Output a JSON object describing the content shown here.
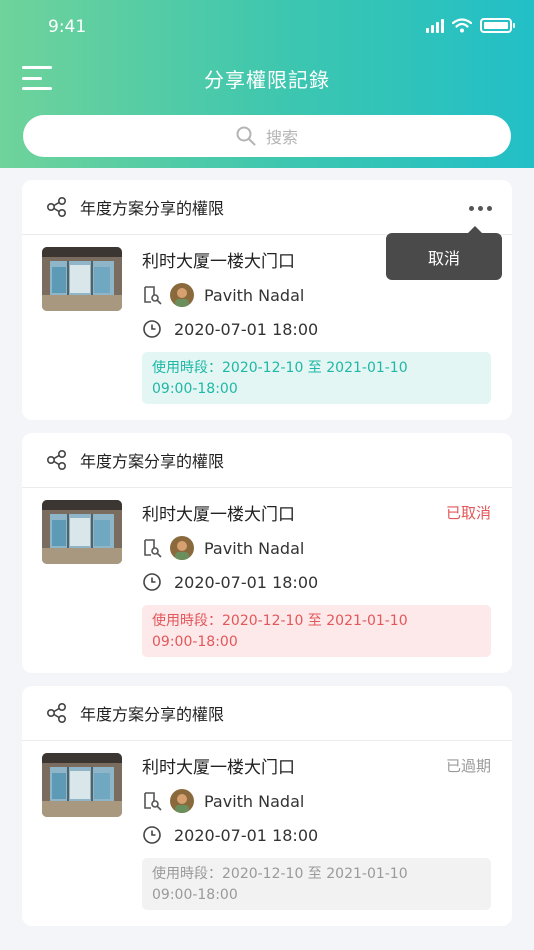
{
  "status_bar": {
    "time": "9:41"
  },
  "header": {
    "title": "分享權限記錄"
  },
  "search": {
    "placeholder": "搜索"
  },
  "cards": [
    {
      "title": "年度方案分享的權限",
      "place": "利时大厦一楼大门口",
      "status": "",
      "user": "Pavith Nadal",
      "datetime": "2020-07-01 18:00",
      "period_line1": "使用時段：2020-12-10 至 2021-01-10",
      "period_line2": "09:00-18:00",
      "state": "active"
    },
    {
      "title": "年度方案分享的權限",
      "place": "利时大厦一楼大门口",
      "status": "已取消",
      "user": "Pavith Nadal",
      "datetime": "2020-07-01 18:00",
      "period_line1": "使用時段：2020-12-10 至 2021-01-10",
      "period_line2": "09:00-18:00",
      "state": "cancelled"
    },
    {
      "title": "年度方案分享的權限",
      "place": "利时大厦一楼大门口",
      "status": "已過期",
      "user": "Pavith Nadal",
      "datetime": "2020-07-01 18:00",
      "period_line1": "使用時段：2020-12-10 至 2021-01-10",
      "period_line2": "09:00-18:00",
      "state": "expired"
    }
  ],
  "popup": {
    "cancel_label": "取消"
  },
  "icons": {
    "menu": "menu-icon",
    "search": "search-icon",
    "share": "share-icon",
    "more": "more-icon",
    "key": "key-icon",
    "clock": "clock-icon"
  },
  "colors": {
    "header_start": "#6fd39a",
    "header_end": "#22bfc7",
    "active": "#1fb8a6",
    "cancelled": "#e2575a",
    "expired": "#9a9a9a"
  }
}
